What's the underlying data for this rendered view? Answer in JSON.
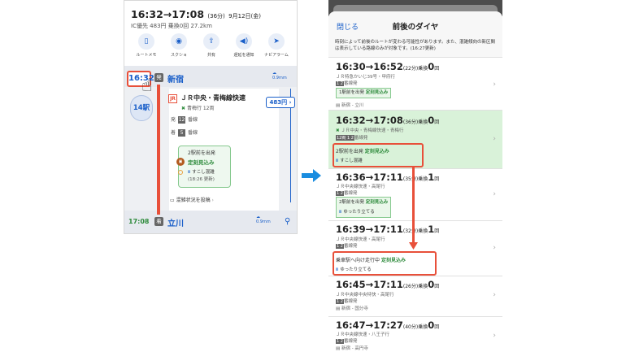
{
  "left": {
    "trip_time": "16:32→17:08",
    "duration": "(36分)",
    "date": "9月12日(金)",
    "fare_line": "IC優先 483円 乗換0回 27.2km",
    "actions": [
      {
        "label": "ルートメモ",
        "icon": "bookmark-icon"
      },
      {
        "label": "スクショ",
        "icon": "camera-icon"
      },
      {
        "label": "共有",
        "icon": "share-icon"
      },
      {
        "label": "遅延を通知",
        "icon": "speaker-icon"
      },
      {
        "label": "ナビアラーム",
        "icon": "navigation-icon"
      }
    ],
    "dep_time": "16:32",
    "dep_badge": "発",
    "dep_station": "新宿",
    "dep_weather": "0.9mm",
    "stops": "14駅",
    "line_icon": "JR",
    "line_name": "ＪＲ中央・青梅線快速",
    "line_sub": "青梅行 12両",
    "plat1_badge": "発",
    "plat1_num": "12",
    "plat1_text": "番線",
    "plat2_badge": "着",
    "plat2_num": "5",
    "plat2_text": "番線",
    "fare": "483円",
    "crowd_title": "2駅前を出発",
    "crowd_status": "定刻見込み",
    "crowd_level": "すこし混雑",
    "crowd_updated": "(18:26 更新)",
    "post": "混雑状況を投稿",
    "arr_time": "17:08",
    "arr_badge": "着",
    "arr_station": "立川",
    "arr_weather": "0.9mm"
  },
  "right": {
    "close": "閉じる",
    "title": "前後のダイヤ",
    "note": "時刻によって前後のルートが変わる可能性があります。また、混雑傾向の新区間は表示している路線のみが対象です。(16:27更新)",
    "rows": [
      {
        "time": "16:30→16:52",
        "dur": "(22分)",
        "xfer_label": "乗換",
        "xfer": "0",
        "xfer_suffix": "回",
        "line": "ＪＲ特急かいじ39号・甲府行",
        "plat": "1 2",
        "plat_suffix": "番線発",
        "chip_title": "1駅前を出発",
        "chip_status": "定刻見込み",
        "extra": "新宿 - 立川"
      },
      {
        "time": "16:32→17:08",
        "dur": "(36分)",
        "xfer_label": "乗換",
        "xfer": "0",
        "xfer_suffix": "回",
        "line": "ＪＲ中央・青梅線快速・青梅行",
        "plat": "12両 1 2",
        "plat_suffix": "番線発",
        "chip_title": "2駅前を出発",
        "chip_status": "定刻見込み",
        "extra": "すこし混雑"
      },
      {
        "time": "16:36→17:11",
        "dur": "(35分)",
        "xfer_label": "乗換",
        "xfer": "1",
        "xfer_suffix": "回",
        "line": "ＪＲ中央線快速・高尾行",
        "plat": "1 2",
        "plat_suffix": "番線発",
        "chip_title": "2駅前を出発",
        "chip_status": "定刻見込み",
        "extra": "ゆったり立てる"
      },
      {
        "time": "16:39→17:11",
        "dur": "(32分)",
        "xfer_label": "乗換",
        "xfer": "1",
        "xfer_suffix": "回",
        "line": "ＪＲ中央線快速・高尾行",
        "plat": "1 2",
        "plat_suffix": "番線発",
        "chip_title": "乗車駅へ向け走行中",
        "chip_status": "定刻見込み",
        "extra": "ゆったり立てる"
      },
      {
        "time": "16:45→17:11",
        "dur": "(26分)",
        "xfer_label": "乗換",
        "xfer": "0",
        "xfer_suffix": "回",
        "line": "ＪＲ中央線中央特快・高尾行",
        "plat": "1 2",
        "plat_suffix": "番線発",
        "extra": "新宿 - 国分寺"
      },
      {
        "time": "16:47→17:27",
        "dur": "(40分)",
        "xfer_label": "乗換",
        "xfer": "0",
        "xfer_suffix": "回",
        "line": "ＪＲ中央線快速・八王子行",
        "plat": "1 2",
        "plat_suffix": "番線発",
        "extra": "新宿 - 高円寺"
      }
    ]
  },
  "colors": {
    "accent": "#1a5fc9",
    "highlight": "#e8503a",
    "ok_green": "#2e8b3c",
    "selected_row": "#d9f2d9"
  }
}
